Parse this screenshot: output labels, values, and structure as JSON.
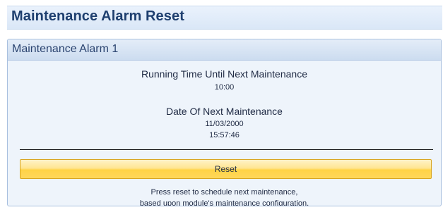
{
  "page_title": "Maintenance Alarm Reset",
  "alarm_panel": {
    "title": "Maintenance Alarm 1",
    "running_time_label": "Running Time Until Next Maintenance",
    "running_time_value": "10:00",
    "date_label": "Date Of Next Maintenance",
    "date_value": "11/03/2000",
    "time_value": "15:57:46",
    "reset_button_label": "Reset",
    "hint_line1": "Press reset to schedule next maintenance,",
    "hint_line2": "based upon module's maintenance configuration."
  },
  "colors": {
    "title_text": "#1e3f6f",
    "panel_background": "#eef4fb",
    "button_accent": "#ffd346"
  }
}
